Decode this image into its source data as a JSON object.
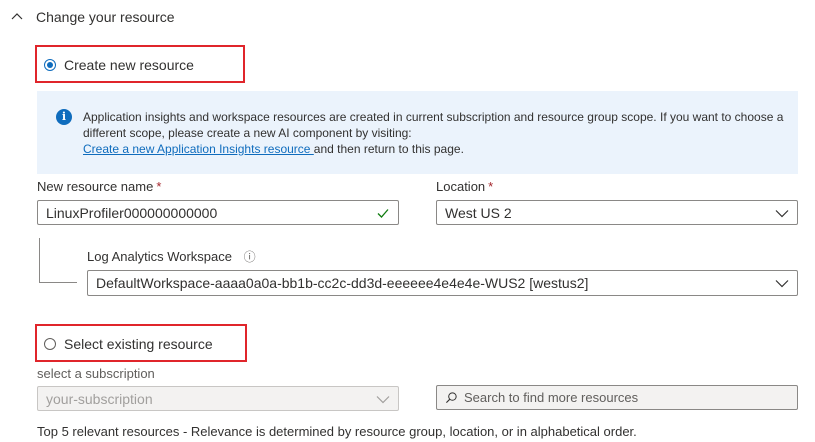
{
  "section": {
    "title": "Change your resource"
  },
  "create_new": {
    "label": "Create new resource",
    "selected": true
  },
  "info": {
    "text": "Application insights and workspace resources are created in current subscription and resource group scope. If you want to choose a different scope, please create a new AI component by visiting:",
    "link_text": "Create a new Application Insights resource ",
    "suffix": "and then return to this page."
  },
  "resource_name": {
    "label": "New resource name",
    "required_mark": "*",
    "value": "LinuxProfiler000000000000"
  },
  "location": {
    "label": "Location",
    "required_mark": "*",
    "value": "West US 2"
  },
  "workspace": {
    "label": "Log Analytics Workspace",
    "info_glyph": "ⓘ",
    "value": "DefaultWorkspace-aaaa0a0a-bb1b-cc2c-dd3d-eeeeee4e4e4e-WUS2 [westus2]"
  },
  "select_existing": {
    "label": "Select existing resource",
    "selected": false
  },
  "subscription": {
    "label": "select a subscription",
    "placeholder": "your-subscription"
  },
  "search": {
    "placeholder": "Search to find more resources"
  },
  "footer": {
    "text": "Top 5 relevant resources - Relevance is determined by resource group, location, or in alphabetical order."
  },
  "colors": {
    "accent": "#0f6cbd",
    "highlight_border": "#e0252b",
    "info_bg": "#ebf3fc",
    "success": "#107c10"
  }
}
